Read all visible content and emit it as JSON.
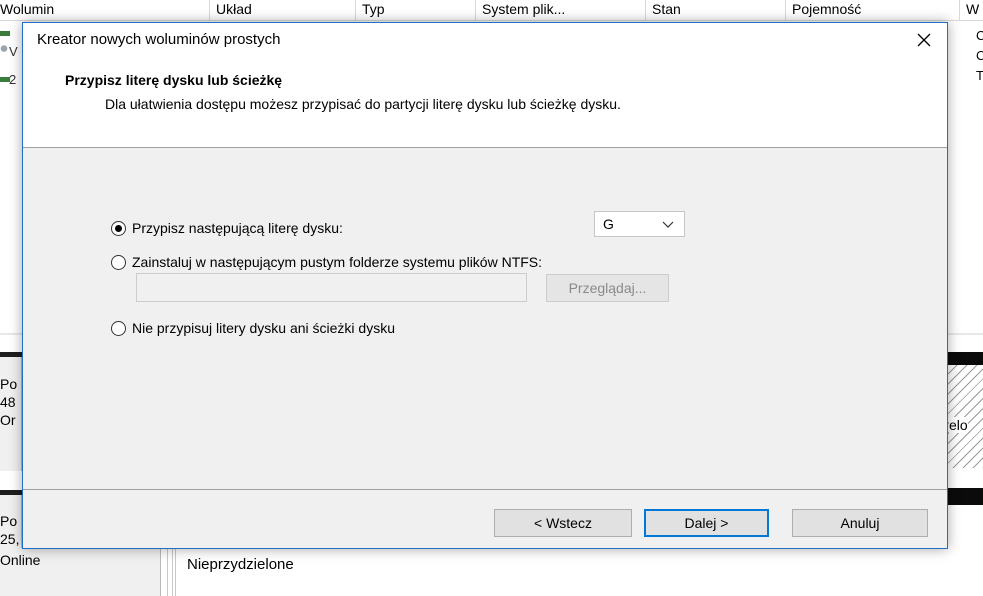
{
  "background": {
    "columns": [
      "Wolumin",
      "Układ",
      "Typ",
      "System plik...",
      "Stan",
      "Pojemność",
      "W"
    ],
    "list_fragments": [
      "V",
      "2"
    ],
    "right_fragments": [
      "C",
      "C",
      "T"
    ],
    "disk1_lines": [
      "Po",
      "48",
      "Or"
    ],
    "disk2_lines": [
      "Po",
      "25,",
      "Online"
    ],
    "disk1_right_label": "elo",
    "unallocated_label": "Nieprzydzielone"
  },
  "dialog": {
    "title": "Kreator nowych woluminów prostych",
    "close_glyph": "✕",
    "heading": "Przypisz literę dysku lub ścieżkę",
    "description": "Dla ułatwienia dostępu możesz przypisać do partycji literę dysku lub ścieżkę dysku.",
    "options": {
      "assign_letter": "Przypisz następującą literę dysku:",
      "mount_folder": "Zainstaluj w następującym pustym folderze systemu plików NTFS:",
      "no_letter": "Nie przypisuj litery dysku ani ścieżki dysku"
    },
    "selected_option": "assign_letter",
    "drive_letter": "G",
    "path_value": "",
    "browse_label": "Przeglądaj...",
    "buttons": {
      "back": "< Wstecz",
      "next": "Dalej >",
      "cancel": "Anuluj"
    }
  },
  "colors": {
    "accent": "#0078d7",
    "dialog_border": "#1f6fc4",
    "dialog_bg": "#f0f0f0"
  }
}
